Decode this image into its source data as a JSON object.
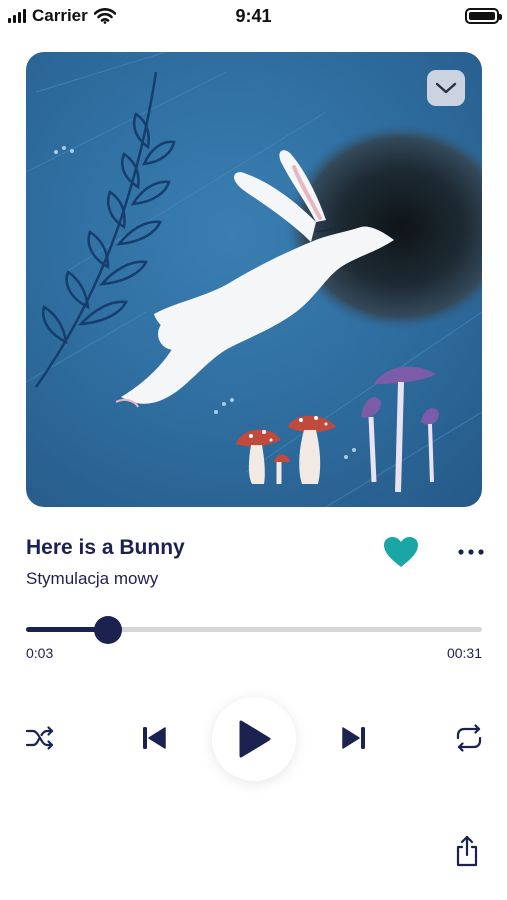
{
  "status_bar": {
    "carrier": "Carrier",
    "time": "9:41",
    "signal_icon": "signal-bars-icon",
    "wifi_icon": "wifi-icon",
    "battery_icon": "battery-icon"
  },
  "track": {
    "title": "Here is a Bunny",
    "subtitle": "Stymulacja mowy",
    "liked": true
  },
  "playback": {
    "elapsed": "0:03",
    "total": "00:31",
    "progress": 0.18
  },
  "controls": {
    "collapse_icon": "chevron-down-icon",
    "favorite_icon": "heart-icon",
    "more_icon": "more-horizontal-icon",
    "shuffle_icon": "shuffle-icon",
    "previous_icon": "skip-previous-icon",
    "play_icon": "play-icon",
    "next_icon": "skip-next-icon",
    "repeat_icon": "repeat-icon",
    "share_icon": "share-icon"
  },
  "colors": {
    "primary": "#1c2250",
    "accent": "#1aa6a4",
    "track_bg": "#d4d6dc",
    "art_blue": "#2f6f9f"
  }
}
